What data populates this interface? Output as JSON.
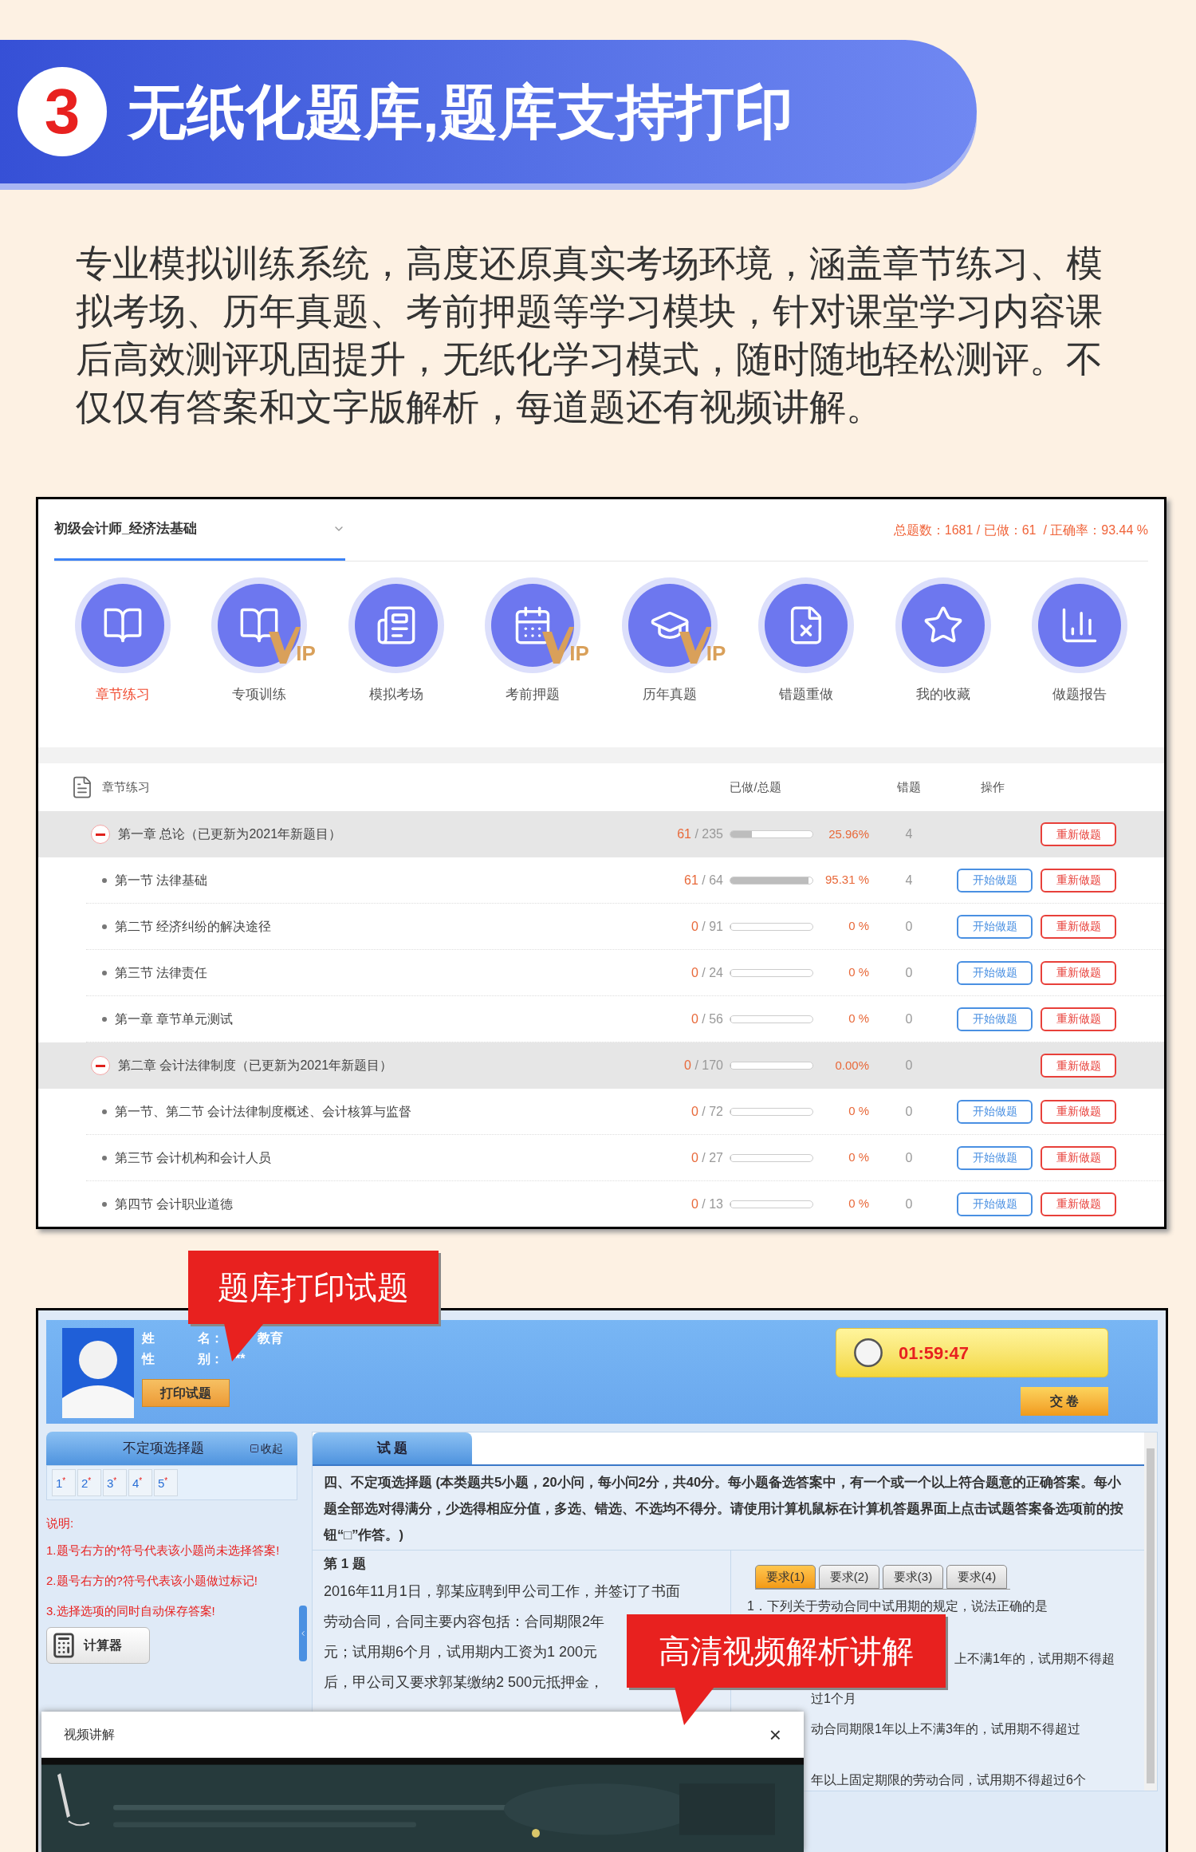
{
  "banner": {
    "number": "3",
    "title": "无纸化题库,题库支持打印"
  },
  "intro": "专业模拟训练系统，高度还原真实考场环境，涵盖章节练习、模拟考场、历年真题、考前押题等学习模块，针对课堂学习内容课后高效测评巩固提升，无纸化学习模式，随时随地轻松测评。不仅仅有答案和文字版解析，每道题还有视频讲解。",
  "practice_window": {
    "subject_select": {
      "value": "初级会计师_经济法基础"
    },
    "stats": "总题数：1681 / 已做：61  / 正确率：93.44 %",
    "modules": [
      {
        "label": "章节练习",
        "selected": true,
        "vip": false
      },
      {
        "label": "专项训练",
        "selected": false,
        "vip": true,
        "badge": "IP"
      },
      {
        "label": "模拟考场",
        "selected": false,
        "vip": false
      },
      {
        "label": "考前押题",
        "selected": false,
        "vip": true,
        "badge": "IP"
      },
      {
        "label": "历年真题",
        "selected": false,
        "vip": true,
        "badge": "IP"
      },
      {
        "label": "错题重做",
        "selected": false,
        "vip": false
      },
      {
        "label": "我的收藏",
        "selected": false,
        "vip": false
      },
      {
        "label": "做题报告",
        "selected": false,
        "vip": false
      }
    ],
    "table": {
      "title": "章节练习",
      "columns": [
        "已做/总题",
        "错题",
        "操作"
      ],
      "chapters": [
        {
          "title": "第一章 总论（已更新为2021年新题目）",
          "expanded": true,
          "done": "61",
          "total": "/ 235",
          "level": 0.2596,
          "percent": "25.96%",
          "errors": "4",
          "actions": [
            {
              "label": "重新做题",
              "kind": "redo"
            }
          ],
          "children": [
            {
              "title": "第一节 法律基础",
              "done": "61",
              "total": "/ 64",
              "level": 0.9531,
              "percent": "95.31 %",
              "errors": "4",
              "actions": [
                {
                  "label": "开始做题",
                  "kind": "start"
                },
                {
                  "label": "重新做题",
                  "kind": "redo"
                }
              ]
            },
            {
              "title": "第二节 经济纠纷的解决途径",
              "done": "0",
              "total": "/ 91",
              "level": 0,
              "percent": "0 %",
              "errors": "0",
              "actions": [
                {
                  "label": "开始做题",
                  "kind": "start"
                },
                {
                  "label": "重新做题",
                  "kind": "redo"
                }
              ]
            },
            {
              "title": "第三节 法律责任",
              "done": "0",
              "total": "/ 24",
              "level": 0,
              "percent": "0 %",
              "errors": "0",
              "actions": [
                {
                  "label": "开始做题",
                  "kind": "start"
                },
                {
                  "label": "重新做题",
                  "kind": "redo"
                }
              ]
            },
            {
              "title": "第一章 章节单元测试",
              "done": "0",
              "total": "/ 56",
              "level": 0,
              "percent": "0 %",
              "errors": "0",
              "actions": [
                {
                  "label": "开始做题",
                  "kind": "start"
                },
                {
                  "label": "重新做题",
                  "kind": "redo"
                }
              ]
            }
          ]
        },
        {
          "title": "第二章 会计法律制度（已更新为2021年新题目）",
          "expanded": true,
          "done": "0",
          "total": "/ 170",
          "level": 0,
          "percent": "0.00%",
          "errors": "0",
          "actions": [
            {
              "label": "重新做题",
              "kind": "redo"
            }
          ],
          "children": [
            {
              "title": "第一节、第二节 会计法律制度概述、会计核算与监督",
              "done": "0",
              "total": "/ 72",
              "level": 0,
              "percent": "0 %",
              "errors": "0",
              "actions": [
                {
                  "label": "开始做题",
                  "kind": "start"
                },
                {
                  "label": "重新做题",
                  "kind": "redo"
                }
              ]
            },
            {
              "title": "第三节 会计机构和会计人员",
              "done": "0",
              "total": "/ 27",
              "level": 0,
              "percent": "0 %",
              "errors": "0",
              "actions": [
                {
                  "label": "开始做题",
                  "kind": "start"
                },
                {
                  "label": "重新做题",
                  "kind": "redo"
                }
              ]
            },
            {
              "title": "第四节 会计职业道德",
              "done": "0",
              "total": "/ 13",
              "level": 0,
              "percent": "0 %",
              "errors": "0",
              "actions": [
                {
                  "label": "开始做题",
                  "kind": "start"
                },
                {
                  "label": "重新做题",
                  "kind": "redo"
                }
              ]
            }
          ]
        }
      ]
    }
  },
  "callouts": [
    "题库打印试题",
    "高清视频解析讲解"
  ],
  "exam_window": {
    "candidate": {
      "fields": [
        {
          "label": "姓 名：",
          "value": "教育"
        },
        {
          "label": "性 别：",
          "value": "**"
        }
      ],
      "print_button": "打印试题"
    },
    "timer": "01:59:47",
    "submit_button": "交 卷",
    "question_panel": {
      "title": "不定项选择题",
      "collapse": "收起",
      "numbers": [
        {
          "label": "1",
          "flag": "*"
        },
        {
          "label": "2",
          "flag": "*"
        },
        {
          "label": "3",
          "flag": "*"
        },
        {
          "label": "4",
          "flag": "*"
        },
        {
          "label": "5",
          "flag": "*"
        }
      ]
    },
    "notes_title": "说明:",
    "notes": [
      "1.题号右方的*符号代表该小题尚未选择答案!",
      "2.题号右方的?符号代表该小题做过标记!",
      "3.选择选项的同时自动保存答案!"
    ],
    "calculator": "计算器",
    "tab": "试 题",
    "instructions": "四、不定项选择题 (本类题共5小题，20小问，每小问2分，共40分。每小题备选答案中，有一个或一个以上符合题意的正确答案。每小题全部选对得满分，少选得相应分值，多选、错选、不选均不得分。请使用计算机鼠标在计算机答题界面上点击试题答案备选项前的按钮“□”作答。)",
    "question_title": "第 1 题",
    "question_lines": [
      "2016年11月1日，郭某应聘到甲公司工作，并签订了书面",
      "劳动合同，合同主要内容包括：合同期限2年",
      "元；试用期6个月，试用期内工资为1 200元",
      "后，甲公司又要求郭某缴纳2 500元抵押金，"
    ],
    "requirement_tabs": [
      {
        "label": "要求(1)",
        "selected": true
      },
      {
        "label": "要求(2)",
        "selected": false
      },
      {
        "label": "要求(3)",
        "selected": false
      },
      {
        "label": "要求(4)",
        "selected": false
      }
    ],
    "requirement_lines": [
      "1．下列关于劳动合同中试用期的规定，说法正确的是",
      "上不满1年的，试用期不得超",
      "过1个月",
      "动合同期限1年以上不满3年的，试用期不得超过",
      "年以上固定期限的劳动合同，试用期不得超过6个"
    ]
  },
  "video_popup": {
    "title": "视频讲解",
    "close": "×",
    "kind": "picture"
  }
}
